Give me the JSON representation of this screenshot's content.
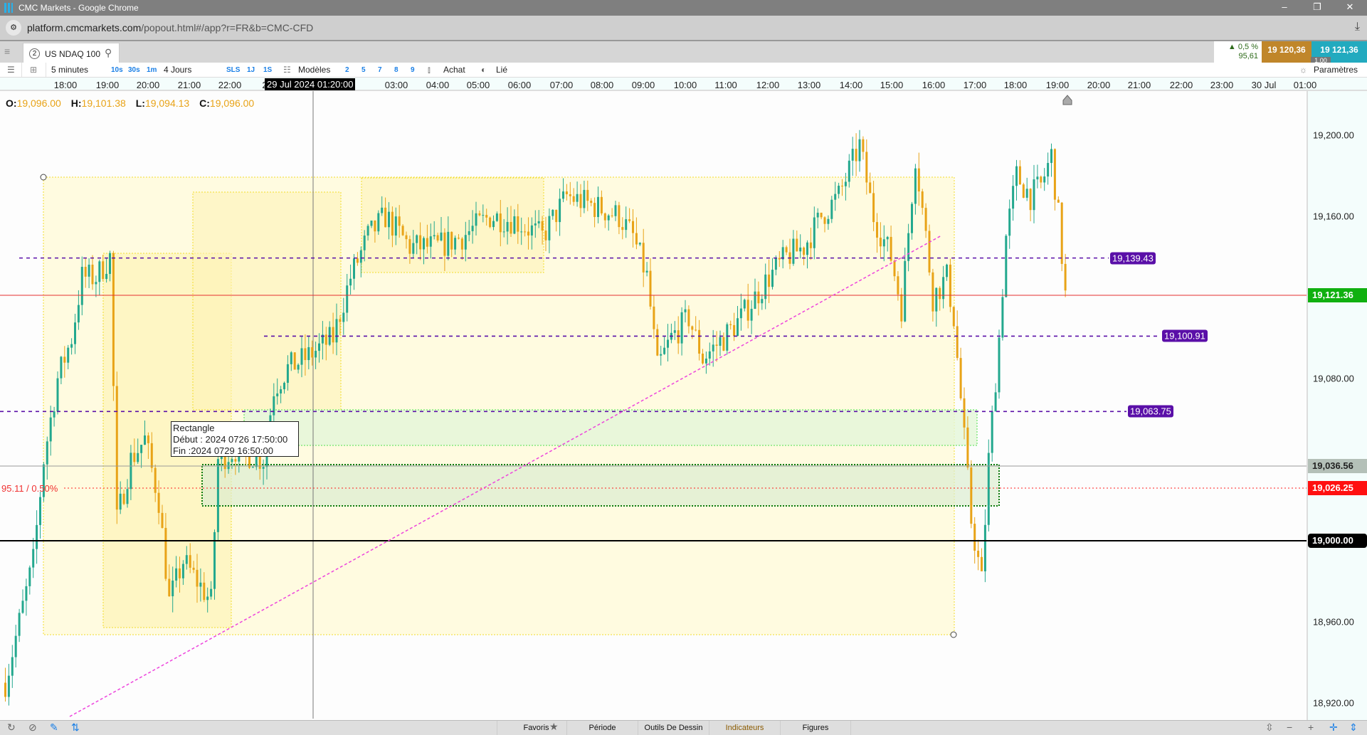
{
  "browser": {
    "title": "CMC Markets - Google Chrome",
    "url_domain": "platform.cmcmarkets.com",
    "url_path": "/popout.html#/app?r=FR&b=CMC-CFD"
  },
  "tab": {
    "number": "2",
    "instrument": "US NDAQ 100"
  },
  "quote": {
    "change": "▲ 0,5 %",
    "change_points": "95,61",
    "sell": "19 120,36",
    "buy": "19 121,36",
    "spread": "1,00"
  },
  "toolbar": {
    "interval": "5 minutes",
    "quick_intervals": [
      "10s",
      "30s",
      "1m"
    ],
    "range": "4 Jours",
    "quick_ranges": [
      "SLS",
      "1J",
      "1S"
    ],
    "templates": "Modèles",
    "presets": [
      "2",
      "5",
      "7",
      "8",
      "9"
    ],
    "trade": "Achat",
    "linked": "Lié",
    "settings": "Paramètres"
  },
  "time_axis": [
    "18:00",
    "19:00",
    "20:00",
    "21:00",
    "22:00",
    "2",
    "03:00",
    "04:00",
    "05:00",
    "06:00",
    "07:00",
    "08:00",
    "09:00",
    "10:00",
    "11:00",
    "12:00",
    "13:00",
    "14:00",
    "15:00",
    "16:00",
    "17:00",
    "18:00",
    "19:00",
    "20:00",
    "21:00",
    "22:00",
    "23:00",
    "30 Jul",
    "01:00"
  ],
  "crosshair_time": "29 Jul 2024 01:20:00",
  "ohlc": {
    "o_label": "O:",
    "o": "19,096.00",
    "h_label": "H:",
    "h": "19,101.38",
    "l_label": "L:",
    "l": "19,094.13",
    "c_label": "C:",
    "c": "19,096.00"
  },
  "price_axis": [
    "19,200.00",
    "19,160.00",
    "19,080.00",
    "18,960.00",
    "18,920.00"
  ],
  "price_axis_values": [
    19200,
    19160,
    19080,
    18960,
    18920
  ],
  "badges": {
    "current": "19,121.36",
    "gray": "19,036.56",
    "red": "19,026.25",
    "black": "19,000.00"
  },
  "horizontal_lines": [
    {
      "value": 19139.43,
      "label": "19,139.43"
    },
    {
      "value": 19100.91,
      "label": "19,100.91"
    },
    {
      "value": 19063.75,
      "label": "19,063.75"
    }
  ],
  "change_line_label": "95.11 / 0.50%",
  "tooltip": {
    "title": "Rectangle",
    "start": "Début : 2024 0726 17:50:00",
    "end": "Fin :2024 0729 16:50:00"
  },
  "bottom": {
    "favorites": "Favoris",
    "period": "Période",
    "drawing_tools": "Outils De Dessin",
    "indicators": "Indicateurs",
    "figures": "Figures"
  },
  "colors": {
    "up": "#23a88e",
    "down": "#e8a317",
    "current": "#10b010",
    "hline": "#5a0fa8"
  },
  "chart_data": {
    "type": "candlestick",
    "interval": "5 minutes",
    "close_path": [
      [
        0,
        18930
      ],
      [
        8,
        18990
      ],
      [
        11,
        19040
      ],
      [
        15,
        19080
      ],
      [
        19,
        19100
      ],
      [
        22,
        19130
      ],
      [
        26,
        19130
      ],
      [
        30,
        19140
      ],
      [
        32,
        19010
      ],
      [
        36,
        19040
      ],
      [
        40,
        19050
      ],
      [
        44,
        19020
      ],
      [
        47,
        18970
      ],
      [
        51,
        18990
      ],
      [
        55,
        18980
      ],
      [
        59,
        18970
      ],
      [
        61,
        19040
      ],
      [
        66,
        19045
      ],
      [
        74,
        19040
      ],
      [
        77,
        19075
      ],
      [
        81,
        19085
      ],
      [
        86,
        19090
      ],
      [
        94,
        19100
      ],
      [
        99,
        19130
      ],
      [
        104,
        19150
      ],
      [
        109,
        19160
      ],
      [
        116,
        19145
      ],
      [
        124,
        19145
      ],
      [
        131,
        19150
      ],
      [
        139,
        19160
      ],
      [
        146,
        19158
      ],
      [
        154,
        19150
      ],
      [
        161,
        19170
      ],
      [
        169,
        19165
      ],
      [
        176,
        19160
      ],
      [
        180,
        19150
      ],
      [
        184,
        19130
      ],
      [
        187,
        19085
      ],
      [
        191,
        19100
      ],
      [
        196,
        19110
      ],
      [
        200,
        19090
      ],
      [
        206,
        19100
      ],
      [
        211,
        19110
      ],
      [
        219,
        19130
      ],
      [
        224,
        19140
      ],
      [
        229,
        19145
      ],
      [
        234,
        19160
      ],
      [
        239,
        19170
      ],
      [
        245,
        19195
      ],
      [
        249,
        19160
      ],
      [
        254,
        19140
      ],
      [
        257,
        19115
      ],
      [
        261,
        19190
      ],
      [
        264,
        19150
      ],
      [
        266,
        19120
      ],
      [
        270,
        19130
      ],
      [
        272,
        19110
      ],
      [
        275,
        19050
      ],
      [
        277,
        19010
      ],
      [
        280,
        18980
      ],
      [
        282,
        19040
      ],
      [
        285,
        19100
      ],
      [
        287,
        19150
      ],
      [
        290,
        19180
      ],
      [
        294,
        19170
      ],
      [
        297,
        19175
      ],
      [
        300,
        19190
      ],
      [
        302,
        19160
      ],
      [
        304,
        19121
      ]
    ]
  }
}
